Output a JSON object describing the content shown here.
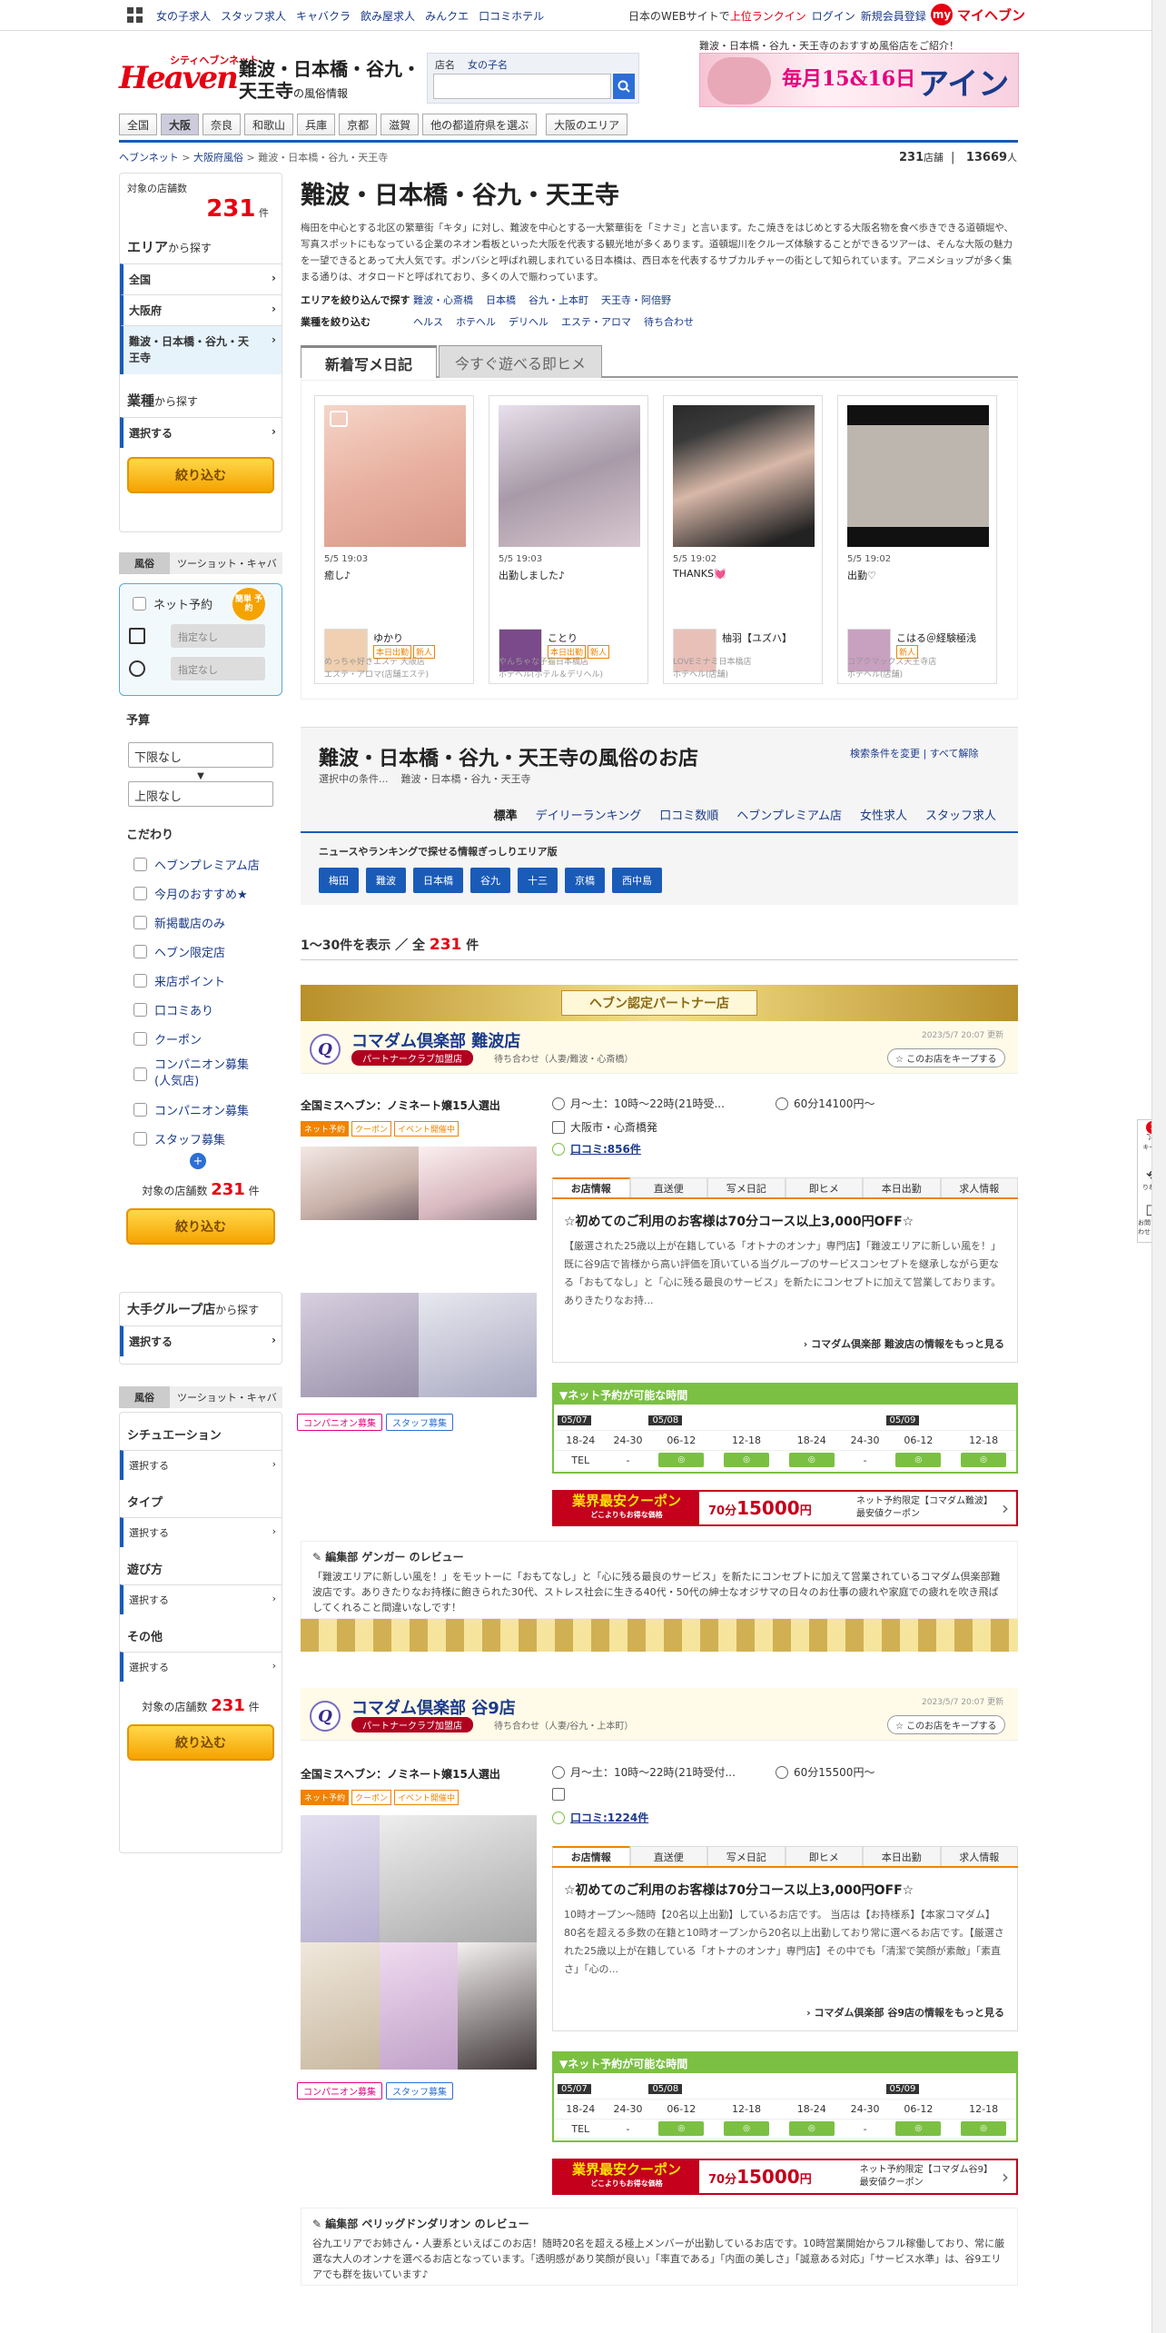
{
  "topbar": {
    "links": [
      "女の子求人",
      "スタッフ求人",
      "キャバクラ",
      "飲み屋求人",
      "みんクエ",
      "口コミホテル"
    ],
    "rank_prefix": "日本のWEBサイトで",
    "rank_label": "上位ランクイン",
    "login": "ログイン",
    "register": "新規会員登録",
    "my_badge": "my",
    "myheaven": "マイヘブン"
  },
  "header": {
    "logo_small": "シティヘブンネット",
    "logo_text": "Heaven",
    "title": "難波・日本橋・谷九・天王寺",
    "title_suffix": "の風俗情報",
    "search_tabs": [
      "店名",
      "女の子名"
    ],
    "search_placeholder": "",
    "promo_caption": "難波・日本橋・谷九・天王寺のおすすめ風俗店をご紹介！",
    "banner_date": "毎月15&16日",
    "banner_title": "アインズ乱"
  },
  "nav": [
    "全国",
    "大阪",
    "奈良",
    "和歌山",
    "兵庫",
    "京都",
    "滋賀",
    "他の都道府県を選ぶ",
    "大阪のエリア"
  ],
  "breadcrumb": [
    "ヘブンネット",
    "大阪府風俗",
    "難波・日本橋・谷九・天王寺"
  ],
  "counts": {
    "shops": "231",
    "shops_unit": "店舗",
    "people": "13669",
    "people_unit": "人"
  },
  "sidebar": {
    "target_label": "対象の店舗数",
    "target_count": "231",
    "target_unit": "件",
    "area_title": "エリア",
    "area_suffix": "から探す",
    "areas": [
      "全国",
      "大阪府",
      "難波・日本橋・谷九・天王寺"
    ],
    "genre_title": "業種",
    "genre_suffix": "から探す",
    "select": "選択する",
    "narrow": "絞り込む",
    "tab_a": "風俗",
    "tab_b": "ツーショット・キャバ",
    "net_reserve": "ネット予約",
    "net_badge": "簡単 予約",
    "date_placeholder": "指定なし",
    "time_placeholder": "指定なし",
    "budget_title": "予算",
    "budget_low": "下限なし",
    "budget_high": "上限なし",
    "kodawari_title": "こだわり",
    "kodawari": [
      "ヘブンプレミアム店",
      "今月のおすすめ★",
      "新掲載店のみ",
      "ヘブン限定店",
      "来店ポイント",
      "口コミあり",
      "クーポン",
      "コンパニオン募集(人気店)",
      "コンパニオン募集",
      "スタッフ募集"
    ],
    "group_title": "大手グループ店",
    "group_suffix": "から探す",
    "situation": "シチュエーション",
    "type": "タイプ",
    "play": "遊び方",
    "other": "その他"
  },
  "main": {
    "title": "難波・日本橋・谷九・天王寺",
    "intro": "梅田を中心とする北区の繁華街「キタ」に対し、難波を中心とする一大繁華街を「ミナミ」と言います。たこ焼きをはじめとする大阪名物を食べ歩きできる道頓堀や、写真スポットにもなっている企業のネオン看板といった大阪を代表する観光地が多くあります。道頓堀川をクルーズ体験することができるツアーは、そんな大阪の魅力を一望できるとあって大人気です。ポンバシと呼ばれ親しまれている日本橋は、西日本を代表するサブカルチャーの街として知られています。アニメショップが多く集まる通りは、オタロードと呼ばれており、多くの人で賑わっています。",
    "filter_area_label": "エリアを絞り込んで探す",
    "filter_areas": [
      "難波・心斎橋",
      "日本橋",
      "谷九・上本町",
      "天王寺・阿倍野"
    ],
    "filter_genre_label": "業種を絞り込む",
    "filter_genres": [
      "ヘルス",
      "ホテヘル",
      "デリヘル",
      "エステ・アロマ",
      "待ち合わせ"
    ],
    "tab_diary": "新着写メ日記",
    "tab_now": "今すぐ遊べる即ヒメ"
  },
  "diary": [
    {
      "time": "5/5 19:03",
      "title": "癒し♪",
      "name": "ゆかり",
      "tags": [
        "本日出勤",
        "新人"
      ],
      "shop": "めっちゃ好きエステ 大阪店",
      "genre": "エステ・アロマ(店舗エステ)"
    },
    {
      "time": "5/5 19:03",
      "title": "出勤しました♪",
      "name": "ことり",
      "tags": [
        "本日出勤",
        "新人"
      ],
      "shop": "やんちゃな子猫日本橋店",
      "genre": "ホテヘル(ホテル＆デリヘル)"
    },
    {
      "time": "5/5 19:02",
      "title": "THANKS💓",
      "name": "柚羽【ユズハ】",
      "tags": [],
      "shop": "LOVEミナミ日本橋店",
      "genre": "ホテヘル(店舗)"
    },
    {
      "time": "5/5 19:02",
      "title": "出勤♡",
      "name": "こはる＠経験極浅",
      "tags": [
        "新人"
      ],
      "shop": "コアクマックス天王寺店",
      "genre": "ホテヘル(店舗)"
    }
  ],
  "list": {
    "title": "難波・日本橋・谷九・天王寺の風俗のお店",
    "selected_label": "選択中の条件...",
    "selected": "難波・日本橋・谷九・天王寺",
    "change": "検索条件を変更",
    "clear": "すべて解除",
    "sorts": [
      "標準",
      "デイリーランキング",
      "口コミ数順",
      "ヘブンプレミアム店",
      "女性求人",
      "スタッフ求人"
    ],
    "news_title": "ニュースやランキングで探せる情報ぎっしりエリア版",
    "news_areas": [
      "梅田",
      "難波",
      "日本橋",
      "谷九",
      "十三",
      "京橋",
      "西中島"
    ],
    "showing_pre": "1～30件を表示 ／ 全",
    "showing_total": "231",
    "showing_unit": "件"
  },
  "partner_banner": "ヘブン認定パートナー店",
  "shops": [
    {
      "name": "コマダム倶楽部 難波店",
      "badge": "パートナークラブ加盟店",
      "category": "待ち合わせ（人妻/難波・心斎橋）",
      "updated": "2023/5/7 20:07 更新",
      "keep": "このお店をキープする",
      "catch": "全国ミスヘブン：ノミネート嬢15人選出",
      "tags": [
        "ネット予約",
        "クーポン",
        "イベント開催中"
      ],
      "sublinks": [
        "コンパニオン募集",
        "スタッフ募集"
      ],
      "hours": "月～土：10時～22時(21時受...",
      "price": "60分14100円～",
      "place": "大阪市・心斎橋発",
      "kuchikomi": "口コミ:856件",
      "tabs": [
        "お店情報",
        "直送便",
        "写メ日記",
        "即ヒメ",
        "本日出勤",
        "求人情報"
      ],
      "campaign": "☆初めてのご利用のお客様は70分コース以上3,000円OFF☆",
      "desc": "【厳選された25歳以上が在籍している「オトナのオンナ」専門店】「難波エリアに新しい風を！」既に谷9店で皆様から高い評価を頂いている当グループのサービスコンセプトを継承しながら更なる「おもてなし」と「心に残る最良のサービス」を新たにコンセプトに加えて営業しております。ありきたりなお持...",
      "more": "コマダム倶楽部 難波店の情報をもっと見る",
      "reserve_title": "▼ネット予約が可能な時間",
      "dates": [
        "05/07",
        "05/08",
        "05/09"
      ],
      "slots": [
        "18-24",
        "24-30",
        "06-12",
        "12-18",
        "18-24",
        "24-30",
        "06-12",
        "12-18"
      ],
      "tel": "TEL",
      "slot_values": [
        "-",
        "-",
        "◎",
        "◎",
        "◎",
        "-",
        "◎",
        "◎"
      ],
      "coupon_label": "業界最安クーポン",
      "coupon_sub": "どこよりもお得な価格",
      "coupon_time": "70分",
      "coupon_price": "15000",
      "coupon_yen": "円",
      "coupon_note1": "ネット予約限定【コマダム難波】",
      "coupon_note2": "最安値クーポン",
      "review_title": "編集部 ゲンガー のレビュー",
      "review": "「難波エリアに新しい風を！」をモットーに「おもてなし」と「心に残る最良のサービス」を新たにコンセプトに加えて営業されているコマダム倶楽部難波店です。ありきたりなお持様に飽きられた30代、ストレス社会に生きる40代・50代の紳士なオジサマの日々のお仕事の疲れや家庭での疲れを吹き飛ばしてくれること間違いなしです！"
    },
    {
      "name": "コマダム倶楽部 谷9店",
      "badge": "パートナークラブ加盟店",
      "category": "待ち合わせ（人妻/谷九・上本町）",
      "updated": "2023/5/7 20:07 更新",
      "keep": "このお店をキープする",
      "catch": "全国ミスヘブン：ノミネート嬢15人選出",
      "tags": [
        "ネット予約",
        "クーポン",
        "イベント開催中"
      ],
      "sublinks": [
        "コンパニオン募集",
        "スタッフ募集"
      ],
      "hours": "月～土：10時～22時(21時受付...",
      "price": "60分15500円～",
      "place": "",
      "kuchikomi": "口コミ:1224件",
      "tabs": [
        "お店情報",
        "直送便",
        "写メ日記",
        "即ヒメ",
        "本日出勤",
        "求人情報"
      ],
      "campaign": "☆初めてのご利用のお客様は70分コース以上3,000円OFF☆",
      "desc": "10時オープン～随時【20名以上出勤】しているお店です。 当店は【お持様系】【本家コマダム】80名を超える多数の在籍と10時オープンから20名以上出勤しており常に選べるお店です。【厳選された25歳以上が在籍している「オトナのオンナ」専門店】その中でも「清潔で笑顔が素敵」「素直さ」「心の...",
      "more": "コマダム倶楽部 谷9店の情報をもっと見る",
      "reserve_title": "▼ネット予約が可能な時間",
      "dates": [
        "05/07",
        "05/08",
        "05/09"
      ],
      "slots": [
        "18-24",
        "24-30",
        "06-12",
        "12-18",
        "18-24",
        "24-30",
        "06-12",
        "12-18"
      ],
      "tel": "TEL",
      "slot_values": [
        "-",
        "-",
        "◎",
        "◎",
        "◎",
        "-",
        "◎",
        "◎"
      ],
      "coupon_label": "業界最安クーポン",
      "coupon_sub": "どこよりもお得な価格",
      "coupon_time": "70分",
      "coupon_price": "15000",
      "coupon_yen": "円",
      "coupon_note1": "ネット予約限定【コマダム谷9】",
      "coupon_note2": "最安値クーポン",
      "review_title": "編集部 ペリッグドンダリオン のレビュー",
      "review": "谷九エリアでお姉さん・人妻系といえばこのお店！随時20名を超える極上メンバーが出勤しているお店です。10時営業開始からフル稼働しており、常に厳選な大人のオンナを選べるお店となっています。「透明感があり笑顔が良い」「率直である」「内面の美しさ」「誠意ある対応」「サービス水準」は、谷9エリアでも群を抜いています♪"
    }
  ],
  "float": {
    "badge": "1",
    "items": [
      "キープ",
      "りれき",
      "お問い合わせ"
    ]
  },
  "colors": {
    "brand_red": "#e60012",
    "link_blue": "#1a3a8a",
    "accent_blue": "#1a5bb8",
    "orange": "#f08300",
    "green": "#7bc043"
  }
}
